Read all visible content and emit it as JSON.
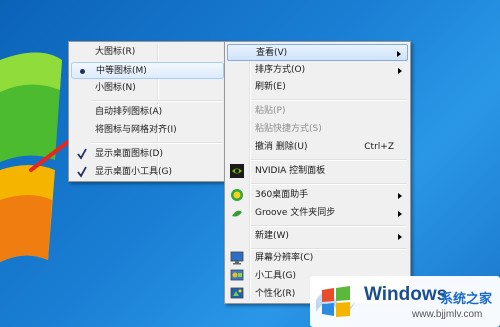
{
  "view_submenu": {
    "items": [
      {
        "label": "大图标(R)"
      },
      {
        "label": "中等图标(M)",
        "selected": true
      },
      {
        "label": "小图标(N)"
      },
      {
        "label": "自动排列图标(A)"
      },
      {
        "label": "将图标与网格对齐(I)"
      },
      {
        "label": "显示桌面图标(D)",
        "checked": true
      },
      {
        "label": "显示桌面小工具(G)",
        "checked": true
      }
    ]
  },
  "context_menu": {
    "items": [
      {
        "label": "查看(V)",
        "submenu": true
      },
      {
        "label": "排序方式(O)",
        "submenu": true
      },
      {
        "label": "刷新(E)"
      },
      {
        "label": "粘贴(P)",
        "disabled": true
      },
      {
        "label": "粘贴快捷方式(S)",
        "disabled": true
      },
      {
        "label": "撤消 删除(U)",
        "shortcut": "Ctrl+Z"
      },
      {
        "label": "NVIDIA 控制面板",
        "icon": "nvidia-icon"
      },
      {
        "label": "360桌面助手",
        "icon": "360-icon",
        "submenu": true
      },
      {
        "label": "Groove 文件夹同步",
        "icon": "groove-icon",
        "submenu": true
      },
      {
        "label": "新建(W)",
        "submenu": true
      },
      {
        "label": "屏幕分辨率(C)",
        "icon": "display-icon"
      },
      {
        "label": "小工具(G)",
        "icon": "gadgets-icon"
      },
      {
        "label": "个性化(R)",
        "icon": "personalize-icon"
      }
    ]
  },
  "watermark": {
    "brand": "Windows",
    "cn": "系统之家",
    "url": "www.bjjmlv.com"
  },
  "colors": {
    "desktop": "#1a7fd4",
    "menu_bg": "#f0f0f0",
    "arrow_annotation": "#e8261c"
  }
}
